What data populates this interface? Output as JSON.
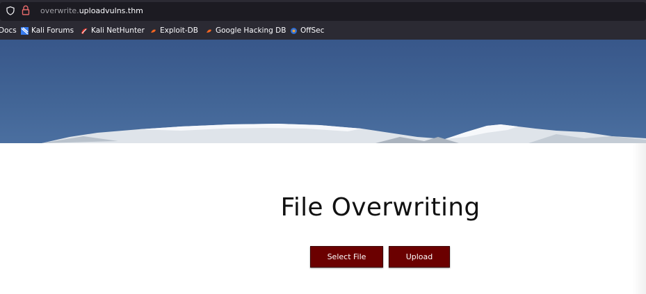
{
  "browser": {
    "url_subdomain": "overwrite.",
    "url_domain": "uploadvulns.thm"
  },
  "bookmarks": [
    {
      "label": "Docs",
      "icon": "kali-docs-icon"
    },
    {
      "label": "Kali Forums",
      "icon": "kali-forums-icon"
    },
    {
      "label": "Kali NetHunter",
      "icon": "kali-nethunter-icon"
    },
    {
      "label": "Exploit-DB",
      "icon": "exploit-db-icon"
    },
    {
      "label": "Google Hacking DB",
      "icon": "ghdb-icon"
    },
    {
      "label": "OffSec",
      "icon": "offsec-icon"
    }
  ],
  "page": {
    "title": "File Overwriting",
    "select_button": "Select File",
    "upload_button": "Upload"
  },
  "colors": {
    "button_bg": "#6b0000",
    "sky": "#426596"
  }
}
